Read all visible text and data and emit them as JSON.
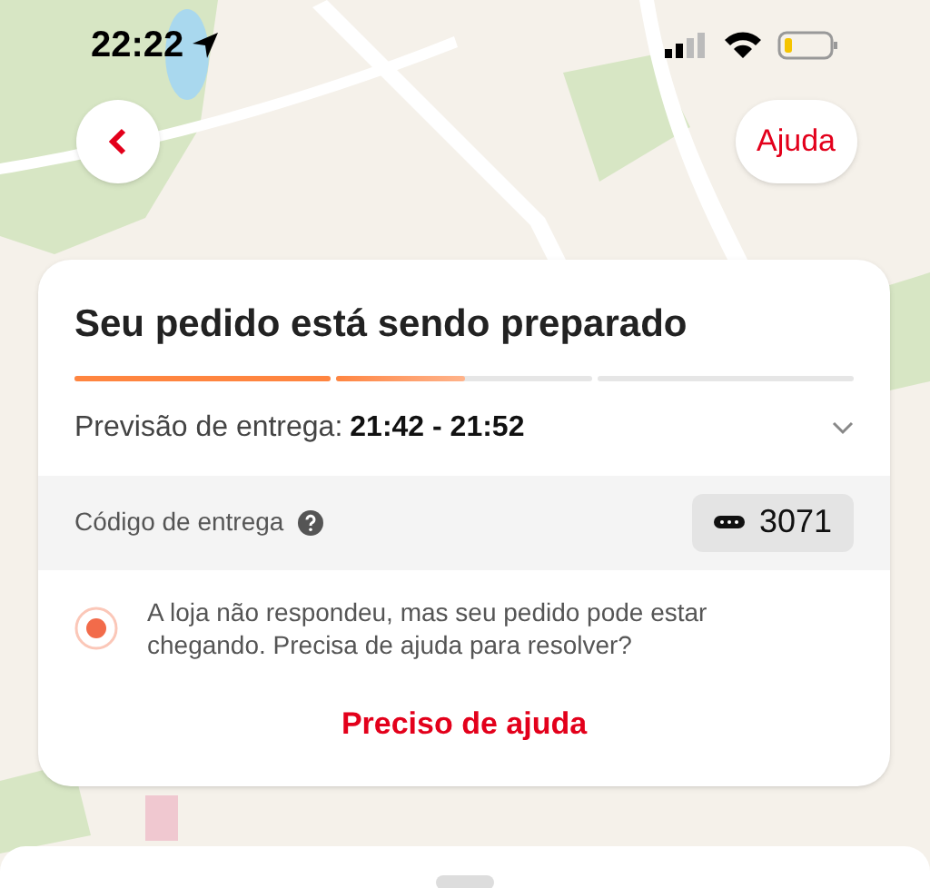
{
  "status_bar": {
    "time": "22:22"
  },
  "header": {
    "help_button": "Ajuda"
  },
  "order_card": {
    "title": "Seu pedido está sendo preparado",
    "progress": [
      {
        "level": 1
      },
      {
        "level": 0.5
      },
      {
        "level": 0
      }
    ],
    "estimate": {
      "label": "Previsão de entrega:",
      "value": "21:42 - 21:52",
      "expanded": false
    },
    "delivery_code": {
      "label": "Código de entrega",
      "code": "3071"
    },
    "alert": {
      "message": "A loja não respondeu, mas seu pedido pode estar chegando. Precisa de ajuda para resolver?"
    },
    "action_button": "Preciso de ajuda"
  }
}
